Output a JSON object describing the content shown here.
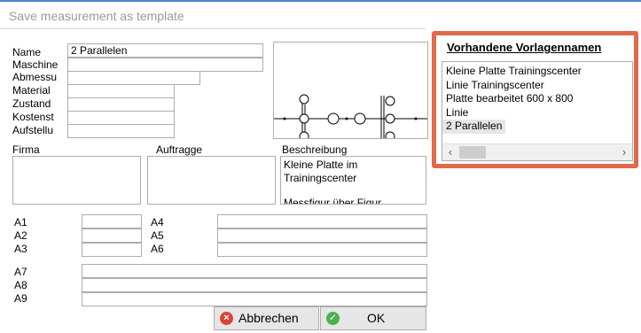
{
  "dialog": {
    "title": "Save measurement as template"
  },
  "form": {
    "name": {
      "label": "Name",
      "value": "2 Parallelen"
    },
    "maschine": {
      "label": "Maschine",
      "value": ""
    },
    "abmessu": {
      "label": "Abmessu",
      "value": ""
    },
    "material": {
      "label": "Material",
      "value": ""
    },
    "zustand": {
      "label": "Zustand",
      "value": ""
    },
    "kostenst": {
      "label": "Kostenst",
      "value": ""
    },
    "aufstellu": {
      "label": "Aufstellu",
      "value": ""
    },
    "firma": {
      "label": "Firma",
      "value": ""
    },
    "auftragge": {
      "label": "Auftragge",
      "value": ""
    },
    "beschreibung": {
      "label": "Beschreibung",
      "line1": "Kleine Platte im",
      "line2": "Trainingscenter",
      "line3": "Messfigur über Figur..."
    },
    "a1": {
      "label": "A1",
      "value": ""
    },
    "a2": {
      "label": "A2",
      "value": ""
    },
    "a3": {
      "label": "A3",
      "value": ""
    },
    "a4": {
      "label": "A4",
      "value": ""
    },
    "a5": {
      "label": "A5",
      "value": ""
    },
    "a6": {
      "label": "A6",
      "value": ""
    },
    "a7": {
      "label": "A7",
      "value": ""
    },
    "a8": {
      "label": "A8",
      "value": ""
    },
    "a9": {
      "label": "A9",
      "value": ""
    }
  },
  "templates_panel": {
    "title": "Vorhandene Vorlagennamen",
    "items": [
      "Kleine Platte Trainingscenter",
      "Linie Trainingscenter",
      "Platte bearbeitet 600 x 800",
      "Linie",
      "2 Parallelen"
    ],
    "selected": "2 Parallelen",
    "scroll_left": "‹",
    "scroll_right": "›"
  },
  "buttons": {
    "cancel": "Abbrechen",
    "ok": "OK",
    "cancel_icon": "×",
    "ok_icon": "✓"
  },
  "colors": {
    "highlight_border": "#e06a4a",
    "cancel_icon": "#d9453a",
    "ok_icon": "#4cb04c"
  }
}
